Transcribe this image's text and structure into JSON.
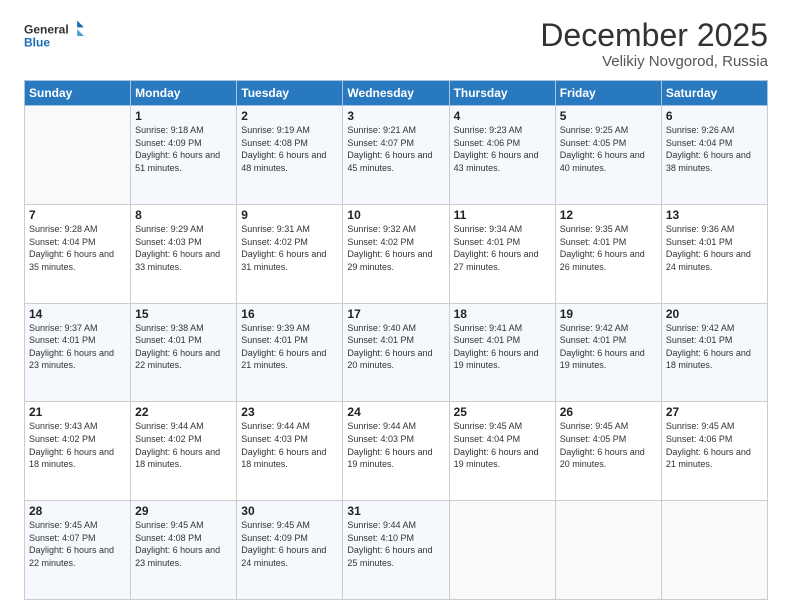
{
  "logo": {
    "line1": "General",
    "line2": "Blue"
  },
  "header": {
    "month": "December 2025",
    "location": "Velikiy Novgorod, Russia"
  },
  "weekdays": [
    "Sunday",
    "Monday",
    "Tuesday",
    "Wednesday",
    "Thursday",
    "Friday",
    "Saturday"
  ],
  "weeks": [
    [
      {
        "day": "",
        "sunrise": "",
        "sunset": "",
        "daylight": ""
      },
      {
        "day": "1",
        "sunrise": "Sunrise: 9:18 AM",
        "sunset": "Sunset: 4:09 PM",
        "daylight": "Daylight: 6 hours and 51 minutes."
      },
      {
        "day": "2",
        "sunrise": "Sunrise: 9:19 AM",
        "sunset": "Sunset: 4:08 PM",
        "daylight": "Daylight: 6 hours and 48 minutes."
      },
      {
        "day": "3",
        "sunrise": "Sunrise: 9:21 AM",
        "sunset": "Sunset: 4:07 PM",
        "daylight": "Daylight: 6 hours and 45 minutes."
      },
      {
        "day": "4",
        "sunrise": "Sunrise: 9:23 AM",
        "sunset": "Sunset: 4:06 PM",
        "daylight": "Daylight: 6 hours and 43 minutes."
      },
      {
        "day": "5",
        "sunrise": "Sunrise: 9:25 AM",
        "sunset": "Sunset: 4:05 PM",
        "daylight": "Daylight: 6 hours and 40 minutes."
      },
      {
        "day": "6",
        "sunrise": "Sunrise: 9:26 AM",
        "sunset": "Sunset: 4:04 PM",
        "daylight": "Daylight: 6 hours and 38 minutes."
      }
    ],
    [
      {
        "day": "7",
        "sunrise": "Sunrise: 9:28 AM",
        "sunset": "Sunset: 4:04 PM",
        "daylight": "Daylight: 6 hours and 35 minutes."
      },
      {
        "day": "8",
        "sunrise": "Sunrise: 9:29 AM",
        "sunset": "Sunset: 4:03 PM",
        "daylight": "Daylight: 6 hours and 33 minutes."
      },
      {
        "day": "9",
        "sunrise": "Sunrise: 9:31 AM",
        "sunset": "Sunset: 4:02 PM",
        "daylight": "Daylight: 6 hours and 31 minutes."
      },
      {
        "day": "10",
        "sunrise": "Sunrise: 9:32 AM",
        "sunset": "Sunset: 4:02 PM",
        "daylight": "Daylight: 6 hours and 29 minutes."
      },
      {
        "day": "11",
        "sunrise": "Sunrise: 9:34 AM",
        "sunset": "Sunset: 4:01 PM",
        "daylight": "Daylight: 6 hours and 27 minutes."
      },
      {
        "day": "12",
        "sunrise": "Sunrise: 9:35 AM",
        "sunset": "Sunset: 4:01 PM",
        "daylight": "Daylight: 6 hours and 26 minutes."
      },
      {
        "day": "13",
        "sunrise": "Sunrise: 9:36 AM",
        "sunset": "Sunset: 4:01 PM",
        "daylight": "Daylight: 6 hours and 24 minutes."
      }
    ],
    [
      {
        "day": "14",
        "sunrise": "Sunrise: 9:37 AM",
        "sunset": "Sunset: 4:01 PM",
        "daylight": "Daylight: 6 hours and 23 minutes."
      },
      {
        "day": "15",
        "sunrise": "Sunrise: 9:38 AM",
        "sunset": "Sunset: 4:01 PM",
        "daylight": "Daylight: 6 hours and 22 minutes."
      },
      {
        "day": "16",
        "sunrise": "Sunrise: 9:39 AM",
        "sunset": "Sunset: 4:01 PM",
        "daylight": "Daylight: 6 hours and 21 minutes."
      },
      {
        "day": "17",
        "sunrise": "Sunrise: 9:40 AM",
        "sunset": "Sunset: 4:01 PM",
        "daylight": "Daylight: 6 hours and 20 minutes."
      },
      {
        "day": "18",
        "sunrise": "Sunrise: 9:41 AM",
        "sunset": "Sunset: 4:01 PM",
        "daylight": "Daylight: 6 hours and 19 minutes."
      },
      {
        "day": "19",
        "sunrise": "Sunrise: 9:42 AM",
        "sunset": "Sunset: 4:01 PM",
        "daylight": "Daylight: 6 hours and 19 minutes."
      },
      {
        "day": "20",
        "sunrise": "Sunrise: 9:42 AM",
        "sunset": "Sunset: 4:01 PM",
        "daylight": "Daylight: 6 hours and 18 minutes."
      }
    ],
    [
      {
        "day": "21",
        "sunrise": "Sunrise: 9:43 AM",
        "sunset": "Sunset: 4:02 PM",
        "daylight": "Daylight: 6 hours and 18 minutes."
      },
      {
        "day": "22",
        "sunrise": "Sunrise: 9:44 AM",
        "sunset": "Sunset: 4:02 PM",
        "daylight": "Daylight: 6 hours and 18 minutes."
      },
      {
        "day": "23",
        "sunrise": "Sunrise: 9:44 AM",
        "sunset": "Sunset: 4:03 PM",
        "daylight": "Daylight: 6 hours and 18 minutes."
      },
      {
        "day": "24",
        "sunrise": "Sunrise: 9:44 AM",
        "sunset": "Sunset: 4:03 PM",
        "daylight": "Daylight: 6 hours and 19 minutes."
      },
      {
        "day": "25",
        "sunrise": "Sunrise: 9:45 AM",
        "sunset": "Sunset: 4:04 PM",
        "daylight": "Daylight: 6 hours and 19 minutes."
      },
      {
        "day": "26",
        "sunrise": "Sunrise: 9:45 AM",
        "sunset": "Sunset: 4:05 PM",
        "daylight": "Daylight: 6 hours and 20 minutes."
      },
      {
        "day": "27",
        "sunrise": "Sunrise: 9:45 AM",
        "sunset": "Sunset: 4:06 PM",
        "daylight": "Daylight: 6 hours and 21 minutes."
      }
    ],
    [
      {
        "day": "28",
        "sunrise": "Sunrise: 9:45 AM",
        "sunset": "Sunset: 4:07 PM",
        "daylight": "Daylight: 6 hours and 22 minutes."
      },
      {
        "day": "29",
        "sunrise": "Sunrise: 9:45 AM",
        "sunset": "Sunset: 4:08 PM",
        "daylight": "Daylight: 6 hours and 23 minutes."
      },
      {
        "day": "30",
        "sunrise": "Sunrise: 9:45 AM",
        "sunset": "Sunset: 4:09 PM",
        "daylight": "Daylight: 6 hours and 24 minutes."
      },
      {
        "day": "31",
        "sunrise": "Sunrise: 9:44 AM",
        "sunset": "Sunset: 4:10 PM",
        "daylight": "Daylight: 6 hours and 25 minutes."
      },
      {
        "day": "",
        "sunrise": "",
        "sunset": "",
        "daylight": ""
      },
      {
        "day": "",
        "sunrise": "",
        "sunset": "",
        "daylight": ""
      },
      {
        "day": "",
        "sunrise": "",
        "sunset": "",
        "daylight": ""
      }
    ]
  ]
}
